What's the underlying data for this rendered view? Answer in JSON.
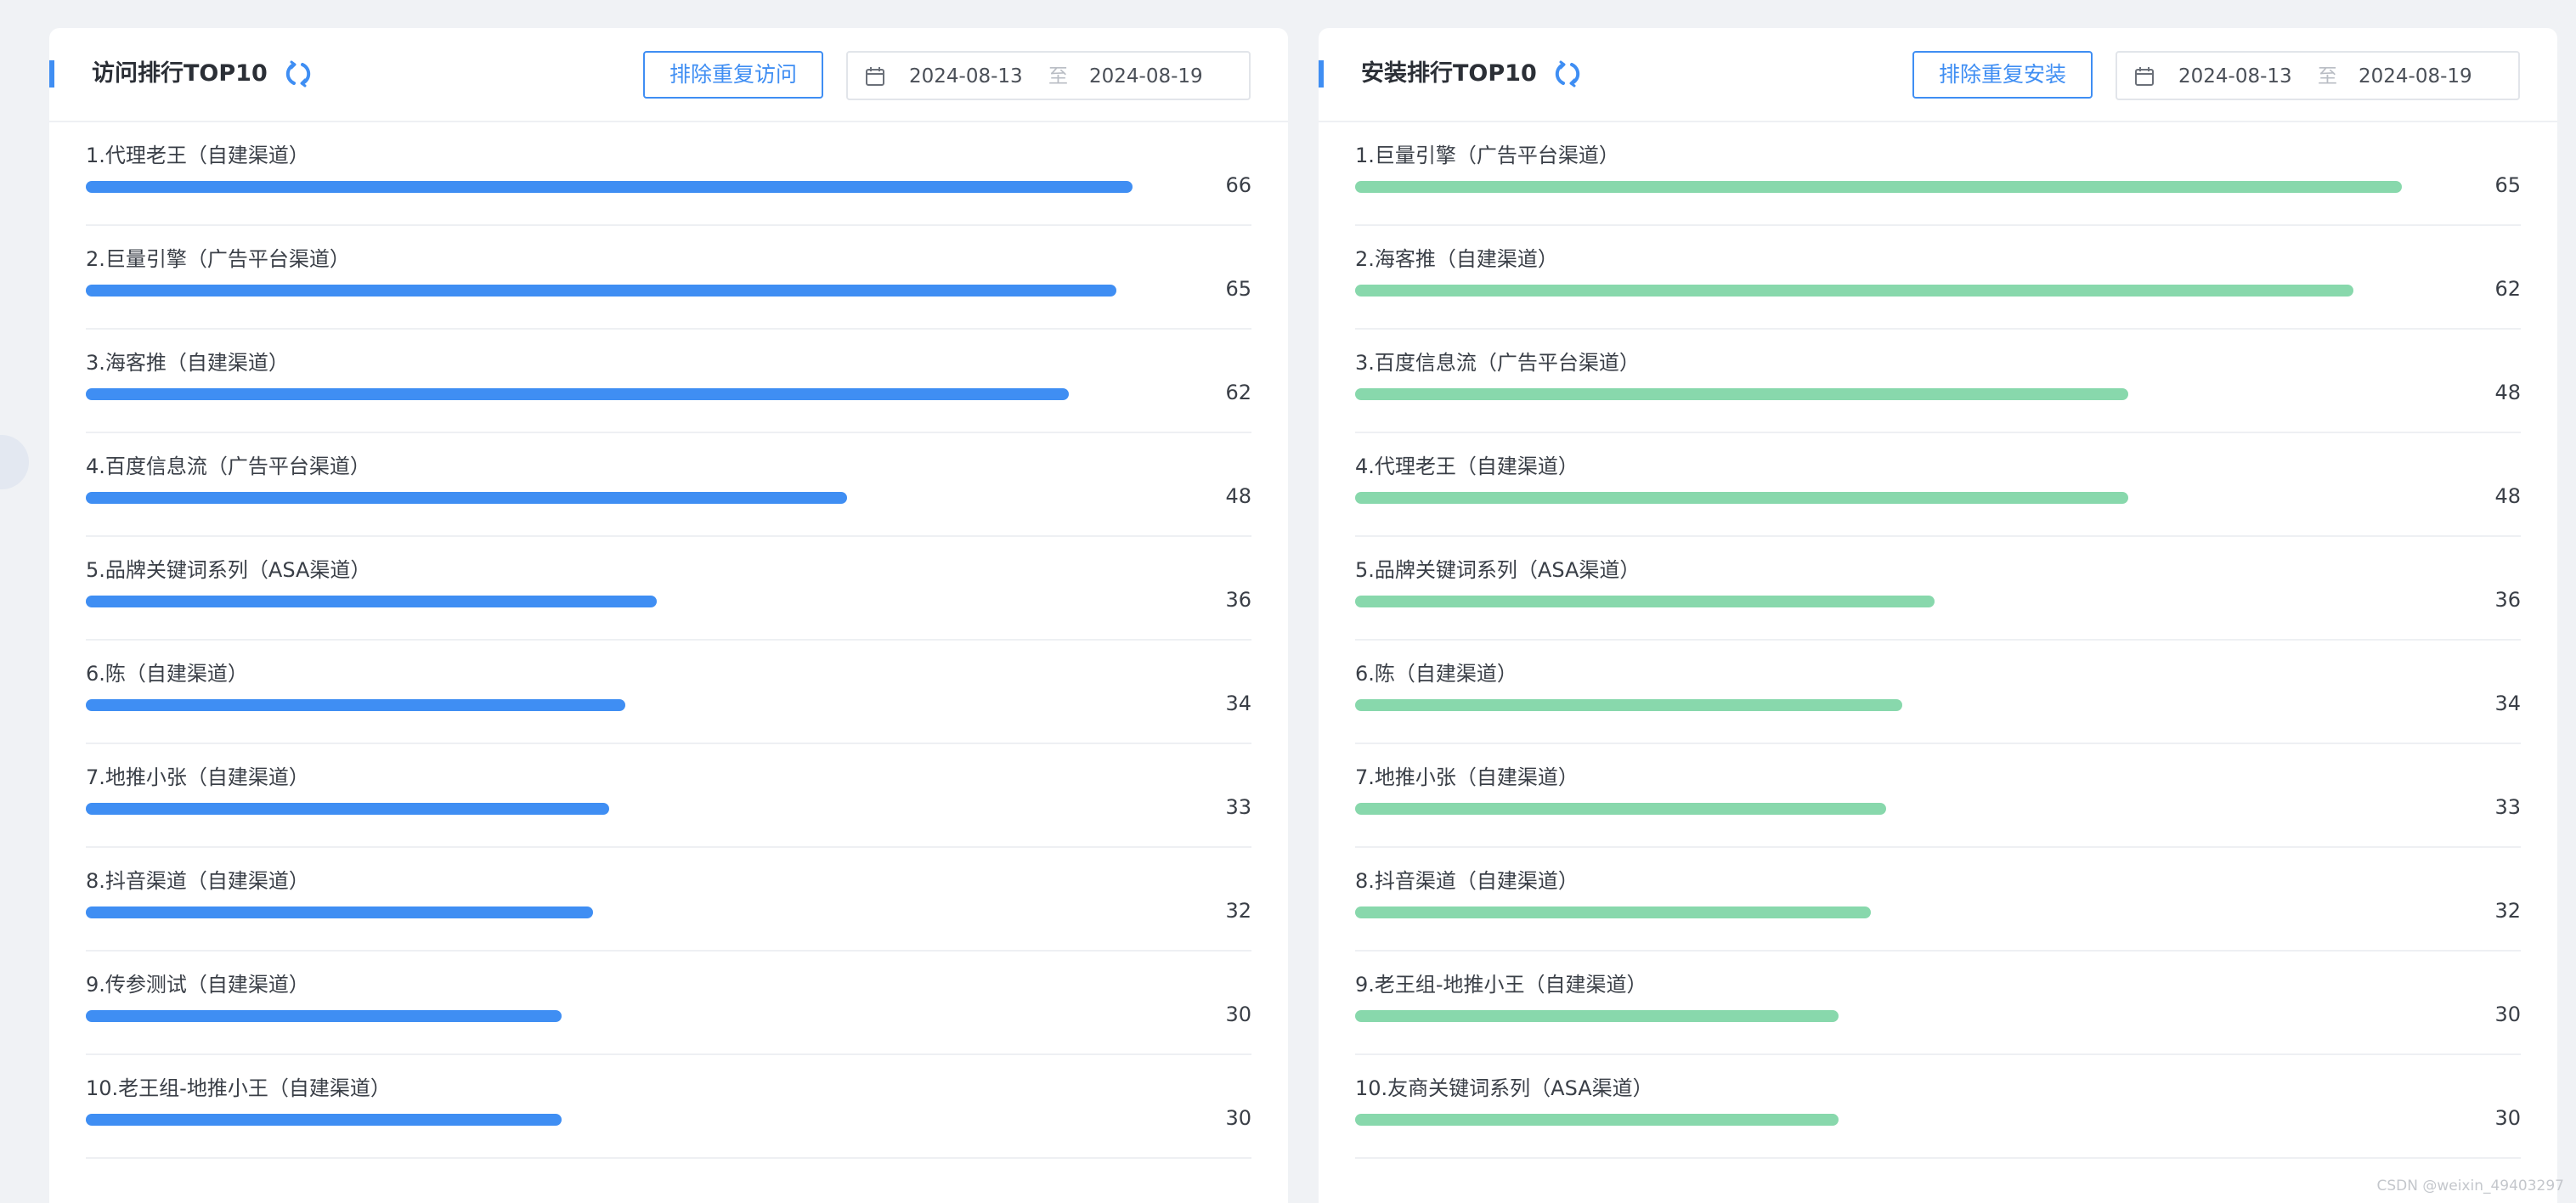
{
  "left_panel": {
    "title": "访问排行TOP10",
    "exclude_button": "排除重复访问",
    "date_start": "2024-08-13",
    "date_separator": "至",
    "date_end": "2024-08-19",
    "bar_color": "#3f8ef3",
    "max_value": 66,
    "items": [
      {
        "label": "1.代理老王（自建渠道）",
        "value": 66
      },
      {
        "label": "2.巨量引擎（广告平台渠道）",
        "value": 65
      },
      {
        "label": "3.海客推（自建渠道）",
        "value": 62
      },
      {
        "label": "4.百度信息流（广告平台渠道）",
        "value": 48
      },
      {
        "label": "5.品牌关键词系列（ASA渠道）",
        "value": 36
      },
      {
        "label": "6.陈（自建渠道）",
        "value": 34
      },
      {
        "label": "7.地推小张（自建渠道）",
        "value": 33
      },
      {
        "label": "8.抖音渠道（自建渠道）",
        "value": 32
      },
      {
        "label": "9.传参测试（自建渠道）",
        "value": 30
      },
      {
        "label": "10.老王组-地推小王（自建渠道）",
        "value": 30
      }
    ]
  },
  "right_panel": {
    "title": "安装排行TOP10",
    "exclude_button": "排除重复安装",
    "date_start": "2024-08-13",
    "date_separator": "至",
    "date_end": "2024-08-19",
    "bar_color": "#88d8ac",
    "max_value": 65,
    "items": [
      {
        "label": "1.巨量引擎（广告平台渠道）",
        "value": 65
      },
      {
        "label": "2.海客推（自建渠道）",
        "value": 62
      },
      {
        "label": "3.百度信息流（广告平台渠道）",
        "value": 48
      },
      {
        "label": "4.代理老王（自建渠道）",
        "value": 48
      },
      {
        "label": "5.品牌关键词系列（ASA渠道）",
        "value": 36
      },
      {
        "label": "6.陈（自建渠道）",
        "value": 34
      },
      {
        "label": "7.地推小张（自建渠道）",
        "value": 33
      },
      {
        "label": "8.抖音渠道（自建渠道）",
        "value": 32
      },
      {
        "label": "9.老王组-地推小王（自建渠道）",
        "value": 30
      },
      {
        "label": "10.友商关键词系列（ASA渠道）",
        "value": 30
      }
    ]
  },
  "icons": {
    "refresh": "refresh-icon",
    "calendar": "calendar-icon"
  },
  "watermark": "CSDN @weixin_49403297"
}
